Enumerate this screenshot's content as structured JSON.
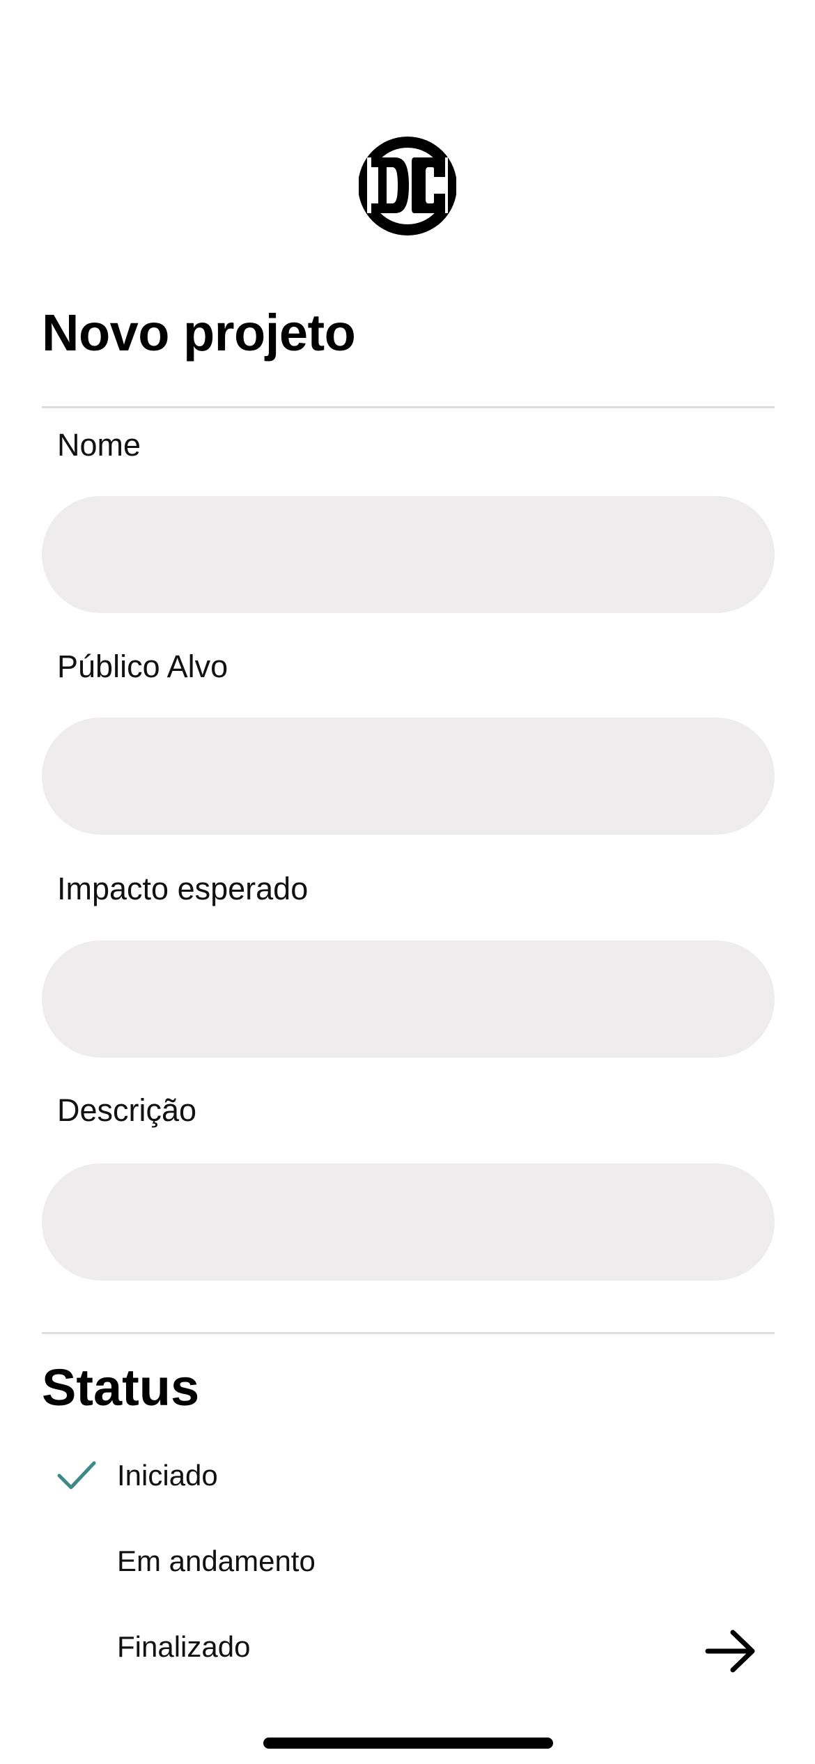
{
  "header": {
    "logo_icon": "dc-logo-icon",
    "title": "Novo projeto"
  },
  "form": {
    "fields": [
      {
        "label": "Nome",
        "value": "",
        "placeholder": ""
      },
      {
        "label": "Público Alvo",
        "value": "",
        "placeholder": ""
      },
      {
        "label": "Impacto esperado",
        "value": "",
        "placeholder": ""
      },
      {
        "label": "Descrição",
        "value": "",
        "placeholder": ""
      }
    ]
  },
  "status": {
    "title": "Status",
    "options": [
      {
        "label": "Iniciado",
        "selected": true
      },
      {
        "label": "Em andamento",
        "selected": false
      },
      {
        "label": "Finalizado",
        "selected": false
      }
    ],
    "check_icon": "checkmark-icon",
    "check_color": "#3a8a86"
  },
  "navigation": {
    "next_icon": "arrow-right-icon"
  },
  "colors": {
    "input_background": "#eeecec",
    "divider": "#dddddd",
    "text": "#000000"
  }
}
